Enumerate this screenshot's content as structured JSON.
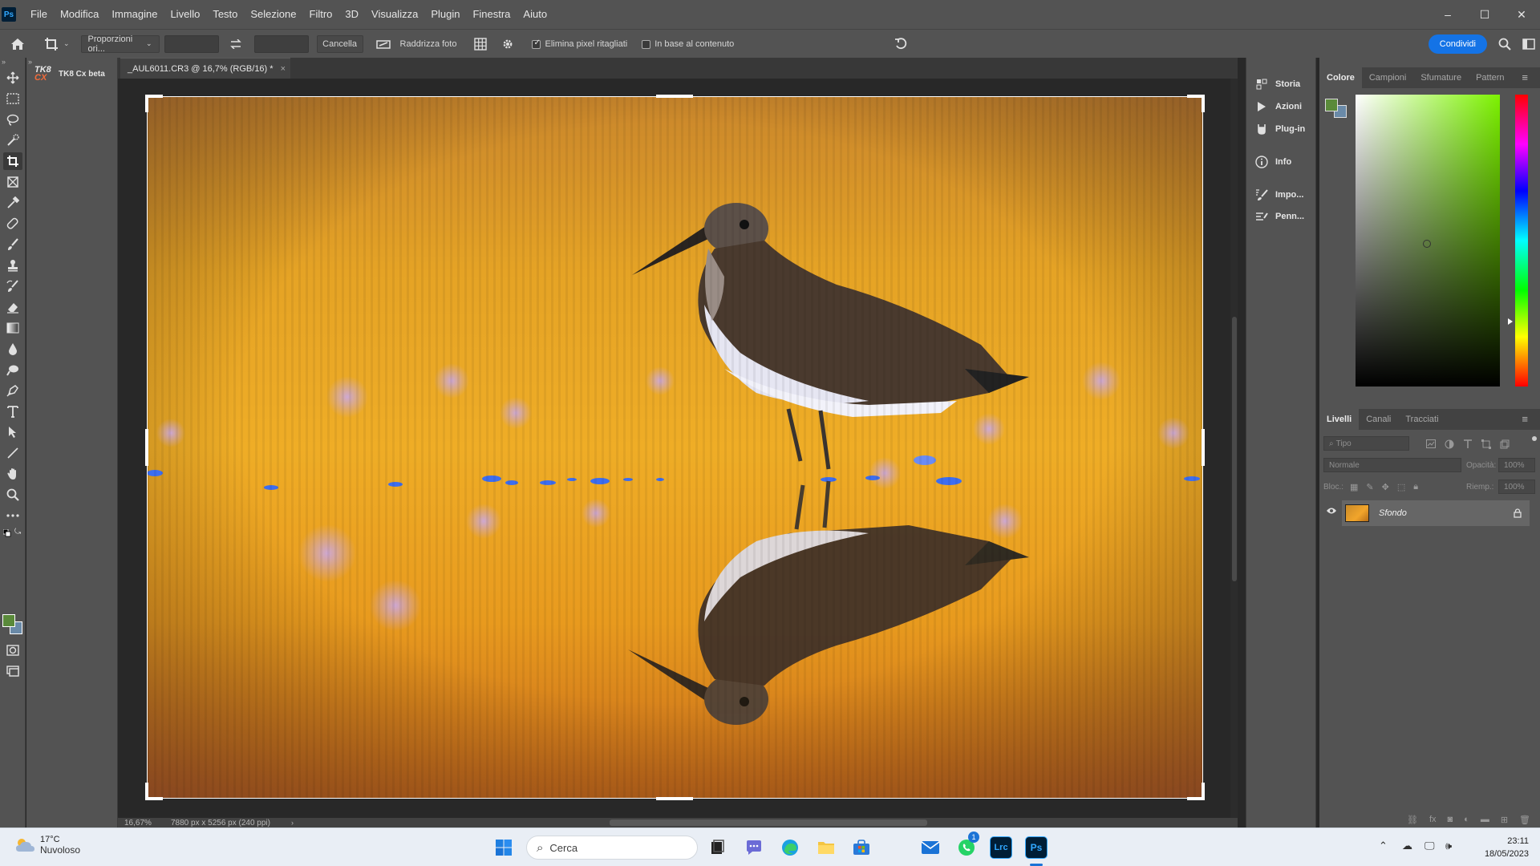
{
  "app": {
    "menu": [
      "File",
      "Modifica",
      "Immagine",
      "Livello",
      "Testo",
      "Selezione",
      "Filtro",
      "3D",
      "Visualizza",
      "Plugin",
      "Finestra",
      "Aiuto"
    ],
    "window_controls": [
      "–",
      "☐",
      "✕"
    ]
  },
  "options_bar": {
    "ratio_select": "Proporzioni ori...",
    "cancel_label": "Cancella",
    "straighten_label": "Raddrizza foto",
    "delete_cropped_label": "Elimina pixel ritagliati",
    "delete_cropped_checked": true,
    "content_aware_label": "In base al contenuto",
    "content_aware_checked": false,
    "share_label": "Condividi"
  },
  "plugin_panel": {
    "logo_top": "TK8",
    "logo_bottom": "CX",
    "name": "TK8 Cx beta"
  },
  "document": {
    "tab_title": "_AUL6011.CR3 @ 16,7% (RGB/16) *",
    "close_symbol": "×",
    "zoom": "16,67%",
    "dimensions": "7880 px x 5256 px (240 ppi)"
  },
  "collapsed_panels": [
    "Storia",
    "Azioni",
    "Plug-in",
    "Info",
    "Impo...",
    "Penn..."
  ],
  "color_panel": {
    "tabs": [
      "Colore",
      "Campioni",
      "Sfumature",
      "Pattern"
    ],
    "foreground": "#5a8a3a",
    "background": "#6a8aa8"
  },
  "layers_panel": {
    "tabs": [
      "Livelli",
      "Canali",
      "Tracciati"
    ],
    "filter_placeholder": "Tipo",
    "blend_mode": "Normale",
    "opacity_label": "Opacità:",
    "opacity_value": "100%",
    "lock_label": "Bloc.:",
    "fill_label": "Riemp.:",
    "fill_value": "100%",
    "layers": [
      {
        "name": "Sfondo",
        "visible": true,
        "locked": true
      }
    ]
  },
  "taskbar": {
    "temperature": "17°C",
    "weather": "Nuvoloso",
    "search_placeholder": "Cerca",
    "whatsapp_badge": "1",
    "time": "23:11",
    "date": "18/05/2023",
    "lrc_label": "Lrc",
    "ps_label": "Ps"
  }
}
